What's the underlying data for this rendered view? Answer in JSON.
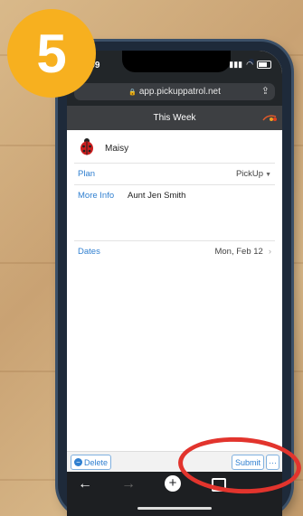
{
  "step_badge": "5",
  "status": {
    "time": ":09"
  },
  "browser": {
    "url": "app.pickuppatrol.net"
  },
  "header": {
    "title": "This Week"
  },
  "person": {
    "name": "Maisy"
  },
  "fields": {
    "plan": {
      "label": "Plan",
      "value": "PickUp"
    },
    "more_info": {
      "label": "More Info",
      "value": "Aunt Jen Smith"
    },
    "dates": {
      "label": "Dates",
      "value": "Mon, Feb 12"
    }
  },
  "toolbar": {
    "delete_label": "Delete",
    "submit_label": "Submit",
    "more_label": "···"
  },
  "colors": {
    "accent": "#2f7fd0",
    "badge": "#f7b01f",
    "ring": "#e2342d"
  },
  "icons": [
    "lock-icon",
    "share-icon",
    "ladybug-icon",
    "back-icon",
    "forward-icon",
    "add-icon",
    "tabs-icon"
  ]
}
